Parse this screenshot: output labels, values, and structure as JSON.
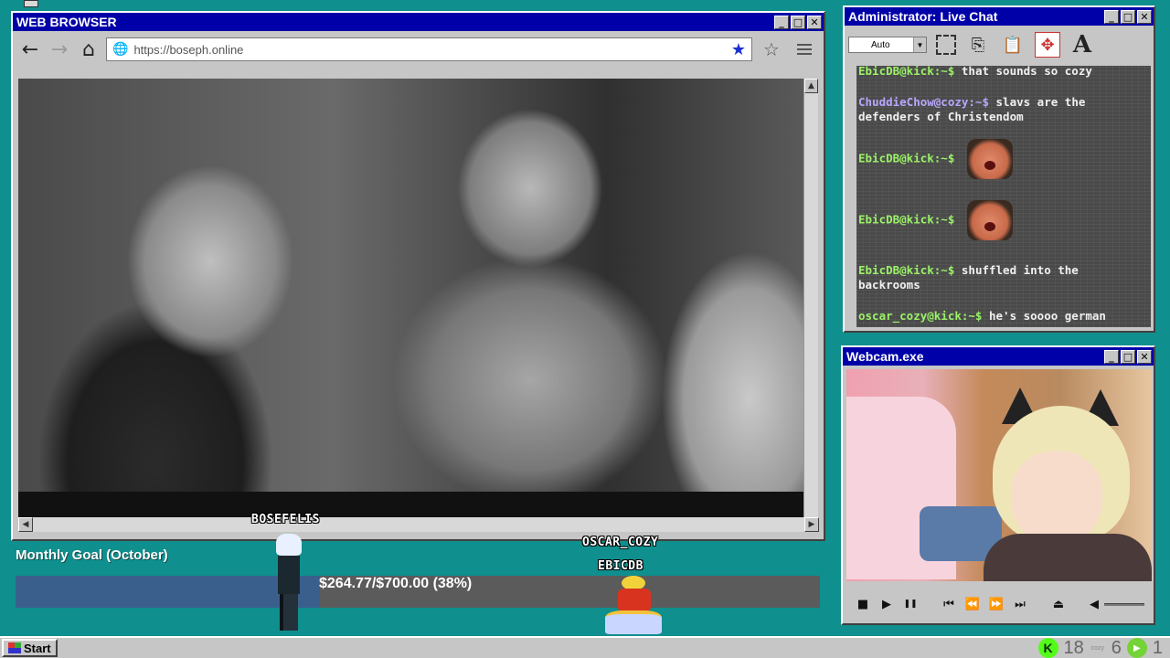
{
  "browser": {
    "title": "WEB BROWSER",
    "url": "https://boseph.online",
    "back_glyph": "←",
    "forward_glyph": "→",
    "home_glyph": "⌂",
    "star_filled": "★",
    "star_outline": "☆"
  },
  "window_buttons": {
    "minimize": "_",
    "maximize": "□",
    "close": "✕"
  },
  "chat": {
    "title": "Administrator: Live Chat",
    "mode_select": "Auto",
    "messages": [
      {
        "user": "EbicDB@kick:~$",
        "text": "that sounds so cozy",
        "emote": false
      },
      {
        "user": "ChuddieChow@cozy:~$",
        "text": "slavs are the defenders of Christendom",
        "emote": false
      },
      {
        "user": "EbicDB@kick:~$",
        "text": "",
        "emote": true
      },
      {
        "user": "EbicDB@kick:~$",
        "text": "",
        "emote": true
      },
      {
        "user": "EbicDB@kick:~$",
        "text": "shuffled into the backrooms",
        "emote": false
      },
      {
        "user": "oscar_cozy@kick:~$",
        "text": "he's soooo german",
        "emote": false
      }
    ]
  },
  "webcam": {
    "title": "Webcam.exe",
    "controls": {
      "stop": "■",
      "play": "▶",
      "pause": "❚❚",
      "prev": "⏮",
      "rewind": "⏪",
      "forward": "⏩",
      "next": "⏭",
      "eject": "⏏",
      "volume": "◀"
    }
  },
  "goal": {
    "title": "Monthly Goal (October)",
    "progress_text": "$264.77/$700.00 (38%)",
    "progress_fraction": 0.378,
    "fill_color": "#3a5f8c",
    "track_color": "#5b5b5b"
  },
  "sprites": [
    {
      "name": "BOSEFELIS"
    },
    {
      "name": "OSCAR_COZY"
    },
    {
      "name": "EBICDB"
    }
  ],
  "taskbar": {
    "start_label": "Start",
    "kick_glyph": "K",
    "kick_count": "18",
    "cozy_label": "cozy",
    "cozy_count": "6",
    "play_glyph": "▶",
    "play_count": "1"
  },
  "colors": {
    "desktop": "#0f8f8d",
    "titlebar": "#0000a8",
    "chat_user": "#9bf267"
  }
}
